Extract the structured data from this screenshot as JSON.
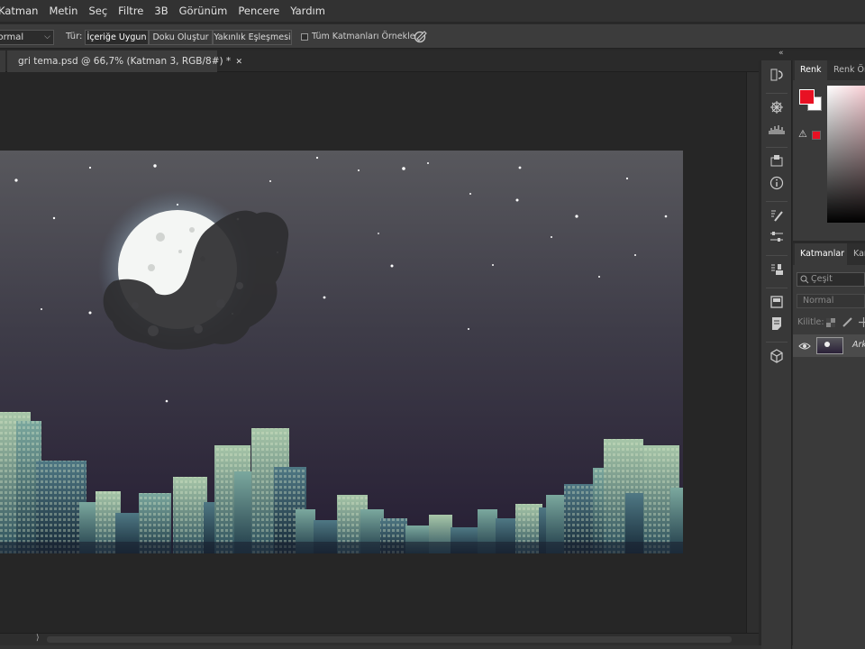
{
  "menu": [
    "Katman",
    "Metin",
    "Seç",
    "Filtre",
    "3B",
    "Görünüm",
    "Pencere",
    "Yardım"
  ],
  "options": {
    "mode_value": "Normal",
    "type_label": "Tür:",
    "type_buttons": [
      "İçeriğe Uygun",
      "Doku Oluştur",
      "Yakınlık Eşleşmesi"
    ],
    "sample_all_label": "Tüm Katmanları Örnekle"
  },
  "document": {
    "tab_title": "gri tema.psd @ 66,7% (Katman 3, RGB/8#) *",
    "close": "✕"
  },
  "color_panel": {
    "tabs": [
      "Renk",
      "Renk Örnekleri"
    ],
    "foreground": "#e81123",
    "background": "#ffffff"
  },
  "layers_panel": {
    "tabs": [
      "Katmanlar",
      "Kanallar"
    ],
    "search_placeholder": "Çeşit",
    "blend_mode": "Normal",
    "lock_label": "Kilitle:",
    "layers": [
      {
        "name": "Arka Plan",
        "visible": true
      }
    ]
  },
  "icons": {
    "collapse": "«",
    "eye": "eye-icon",
    "search": "search-icon",
    "brush": "healing-brush-icon"
  },
  "scroll": {
    "h_arrow": "⟩"
  }
}
